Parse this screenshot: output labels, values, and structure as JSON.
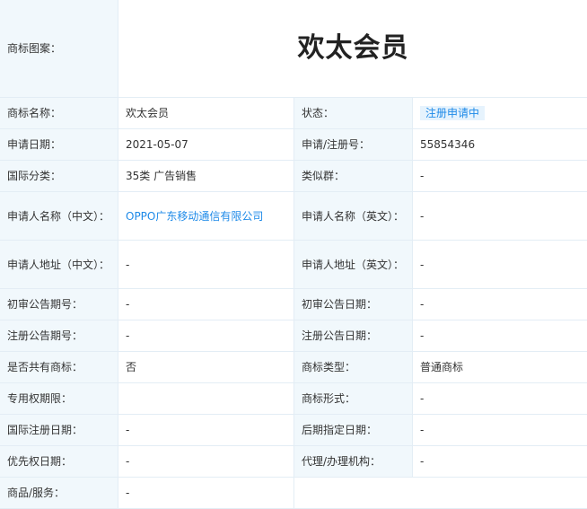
{
  "image_row": {
    "label": "商标图案：",
    "mark_text": "欢太会员"
  },
  "rows": [
    {
      "l1": "商标名称：",
      "v1": "欢太会员",
      "l2": "状态：",
      "v2": "注册申请中"
    },
    {
      "l1": "申请日期：",
      "v1": "2021-05-07",
      "l2": "申请/注册号：",
      "v2": "55854346"
    },
    {
      "l1": "国际分类：",
      "v1": "35类 广告销售",
      "l2": "类似群：",
      "v2": "-"
    },
    {
      "l1": "申请人名称（中文）：",
      "v1": "OPPO广东移动通信有限公司",
      "l2": "申请人名称（英文）：",
      "v2": "-"
    },
    {
      "l1": "申请人地址（中文）：",
      "v1": "-",
      "l2": "申请人地址（英文）：",
      "v2": "-"
    },
    {
      "l1": "初审公告期号：",
      "v1": "-",
      "l2": "初审公告日期：",
      "v2": "-"
    },
    {
      "l1": "注册公告期号：",
      "v1": "-",
      "l2": "注册公告日期：",
      "v2": "-"
    },
    {
      "l1": "是否共有商标：",
      "v1": "否",
      "l2": "商标类型：",
      "v2": "普通商标"
    },
    {
      "l1": "专用权期限：",
      "v1": "",
      "l2": "商标形式：",
      "v2": "-"
    },
    {
      "l1": "国际注册日期：",
      "v1": "-",
      "l2": "后期指定日期：",
      "v2": "-"
    },
    {
      "l1": "优先权日期：",
      "v1": "-",
      "l2": "代理/办理机构：",
      "v2": "-"
    }
  ],
  "goods": {
    "label": "商品/服务：",
    "value": "-"
  },
  "colors": {
    "accent": "#1e8ae8",
    "label_bg": "#f1f8fc",
    "border": "#e3edf5"
  }
}
